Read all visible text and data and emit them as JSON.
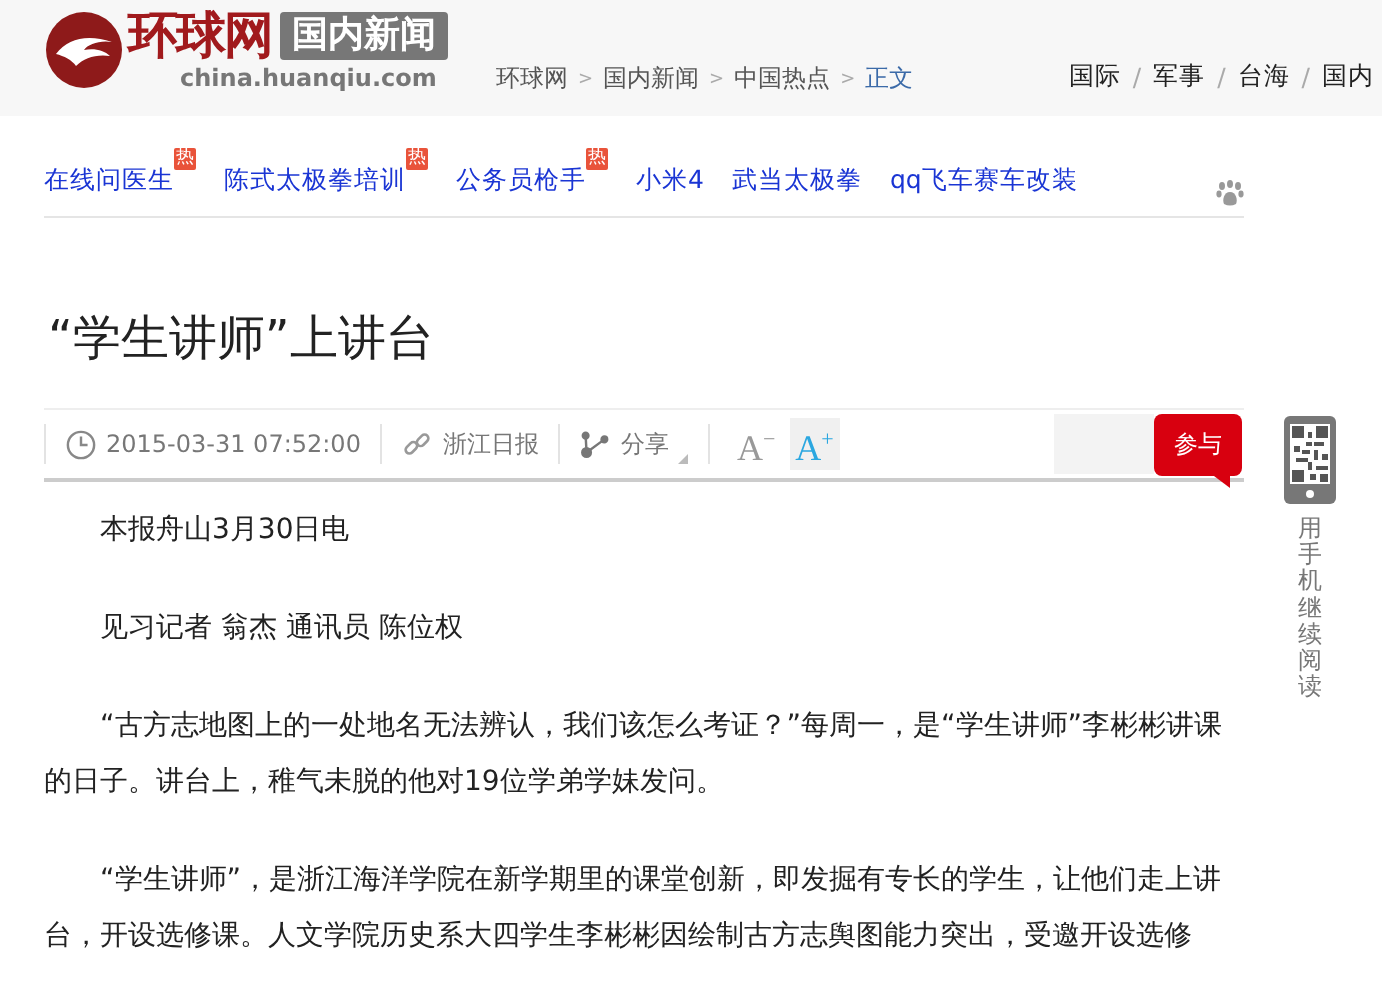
{
  "header": {
    "logo_text": "环球网",
    "channel": "国内新闻",
    "domain": "china.huanqiu.com",
    "breadcrumb": [
      {
        "label": "环球网",
        "current": false
      },
      {
        "label": "国内新闻",
        "current": false
      },
      {
        "label": "中国热点",
        "current": false
      },
      {
        "label": "正文",
        "current": true
      }
    ],
    "breadcrumb_separator": ">",
    "nav": [
      "国际",
      "军事",
      "台海",
      "国内"
    ],
    "nav_separator": "/"
  },
  "hot_links": [
    {
      "label": "在线问医生",
      "badge": "热"
    },
    {
      "label": "陈式太极拳培训",
      "badge": "热"
    },
    {
      "label": "公务员枪手",
      "badge": "热"
    },
    {
      "label": "小米4"
    },
    {
      "label": "武当太极拳"
    },
    {
      "label": "qq飞车赛车改装"
    }
  ],
  "article": {
    "title": "“学生讲师”上讲台",
    "toolbar": {
      "time": "2015-03-31 07:52:00",
      "source": "浙江日报",
      "share": "分享",
      "font_buttons": [
        {
          "letter": "A",
          "sign": "−",
          "selected": false
        },
        {
          "letter": "A",
          "sign": "+",
          "selected": true
        }
      ],
      "join": "参与"
    },
    "paragraphs": [
      "本报舟山3月30日电",
      "见习记者 翁杰 通讯员 陈位权",
      "“古方志地图上的一处地名无法辨认，我们该怎么考证？”每周一，是“学生讲师”李彬彬讲课的日子。讲台上，稚气未脱的他对19位学弟学妹发问。",
      "“学生讲师”，是浙江海洋学院在新学期里的课堂创新，即发掘有专长的学生，让他们走上讲台，开设选修课。人文学院历史系大四学生李彬彬因绘制古方志舆图能力突出，受邀开设选修"
    ]
  },
  "mobile_read": "用手机继续阅读"
}
